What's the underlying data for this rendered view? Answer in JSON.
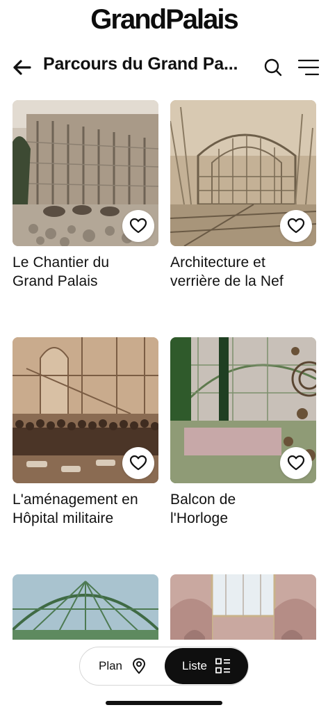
{
  "app": {
    "logo_text": "GrandPalais"
  },
  "header": {
    "title": "Parcours du Grand Pa..."
  },
  "cards": [
    {
      "title_line1": "Le Chantier du",
      "title_line2": "Grand Palais"
    },
    {
      "title_line1": "Architecture et",
      "title_line2": "verrière de la Nef"
    },
    {
      "title_line1": "L'aménagement en",
      "title_line2": "Hôpital militaire"
    },
    {
      "title_line1": "Balcon de",
      "title_line2": "l'Horloge"
    }
  ],
  "bottom_toggle": {
    "plan_label": "Plan",
    "list_label": "Liste",
    "selected": "Liste"
  },
  "icons": {
    "back": "arrow-left-icon",
    "search": "search-icon",
    "menu": "menu-icon",
    "favorite": "heart-outline-icon",
    "plan": "map-pin-icon",
    "list": "list-view-icon"
  },
  "colors": {
    "accent": "#0f0f0f",
    "background": "#ffffff",
    "text": "#111111"
  }
}
